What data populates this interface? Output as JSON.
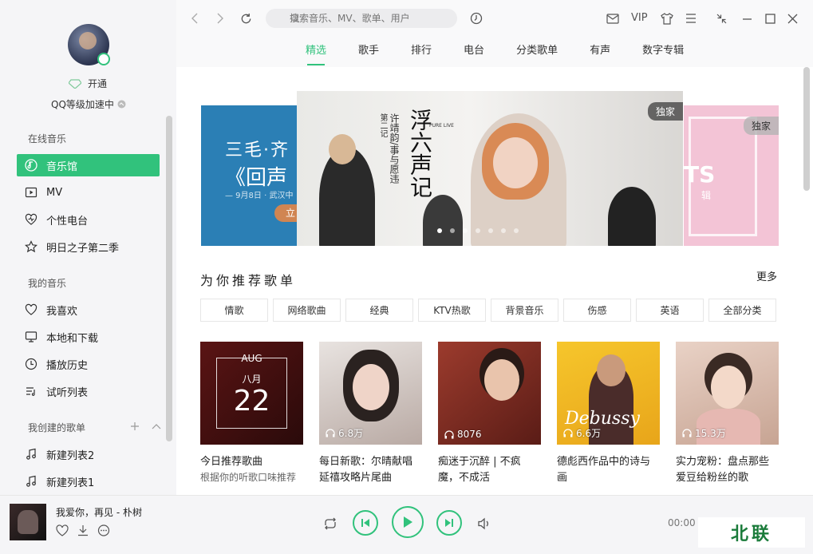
{
  "colors": {
    "accent": "#31c27c"
  },
  "profile": {
    "vip_label": "开通",
    "level_text": "QQ等级加速中"
  },
  "sidebar": {
    "online_title": "在线音乐",
    "online_items": [
      {
        "label": "音乐馆",
        "icon": "music-hall-icon",
        "active": true
      },
      {
        "label": "MV",
        "icon": "mv-icon"
      },
      {
        "label": "个性电台",
        "icon": "radio-heart-icon"
      },
      {
        "label": "明日之子第二季",
        "icon": "star-icon"
      }
    ],
    "my_title": "我的音乐",
    "my_items": [
      {
        "label": "我喜欢",
        "icon": "heart-icon"
      },
      {
        "label": "本地和下载",
        "icon": "monitor-icon"
      },
      {
        "label": "播放历史",
        "icon": "clock-icon"
      },
      {
        "label": "试听列表",
        "icon": "list-icon"
      }
    ],
    "created_title": "我创建的歌单",
    "created_items": [
      {
        "label": "新建列表2",
        "icon": "note-icon"
      },
      {
        "label": "新建列表1",
        "icon": "note-icon"
      }
    ]
  },
  "topbar": {
    "search_placeholder": "搜索音乐、MV、歌单、用户",
    "vip_label": "VIP",
    "tabs": [
      "精选",
      "歌手",
      "排行",
      "电台",
      "分类歌单",
      "有声",
      "数字专辑"
    ]
  },
  "banner": {
    "left_line1": "三毛·齐",
    "left_line2": "《回声",
    "left_line3": "— 9月8日 · 武汉中",
    "left_button": "立",
    "main_badge": "独家",
    "main_title": "浮六声记",
    "main_sub": "许靖韵/事与愿违",
    "main_side": "第二记",
    "main_tag": "PURE LIVE",
    "right_badge": "独家",
    "right_text": "TS",
    "right_small": "辑"
  },
  "recommend": {
    "title": "为你推荐歌单",
    "more": "更多",
    "categories": [
      "情歌",
      "网络歌曲",
      "经典",
      "KTV热歌",
      "背景音乐",
      "伤感",
      "英语",
      "全部分类"
    ],
    "cards": [
      {
        "title": "今日推荐歌曲",
        "sub": "根据你的听歌口味推荐",
        "plays": "",
        "month": "AUG",
        "month_cn": "八月",
        "day": "22"
      },
      {
        "title": "每日新歌：尔晴献唱延禧攻略片尾曲",
        "sub": "",
        "plays": "6.8万"
      },
      {
        "title": "痴迷于沉醉 | 不疯魔，不成活",
        "sub": "",
        "plays": "8076"
      },
      {
        "title": "德彪西作品中的诗与画",
        "sub": "",
        "plays": "6.6万",
        "cover_text": "Debussy"
      },
      {
        "title": "实力宠粉：盘点那些爱豆给粉丝的歌",
        "sub": "",
        "plays": "15.3万"
      }
    ]
  },
  "player": {
    "song": "我爱你，再见 - 朴树",
    "time": "00:00"
  },
  "watermark": "北联"
}
